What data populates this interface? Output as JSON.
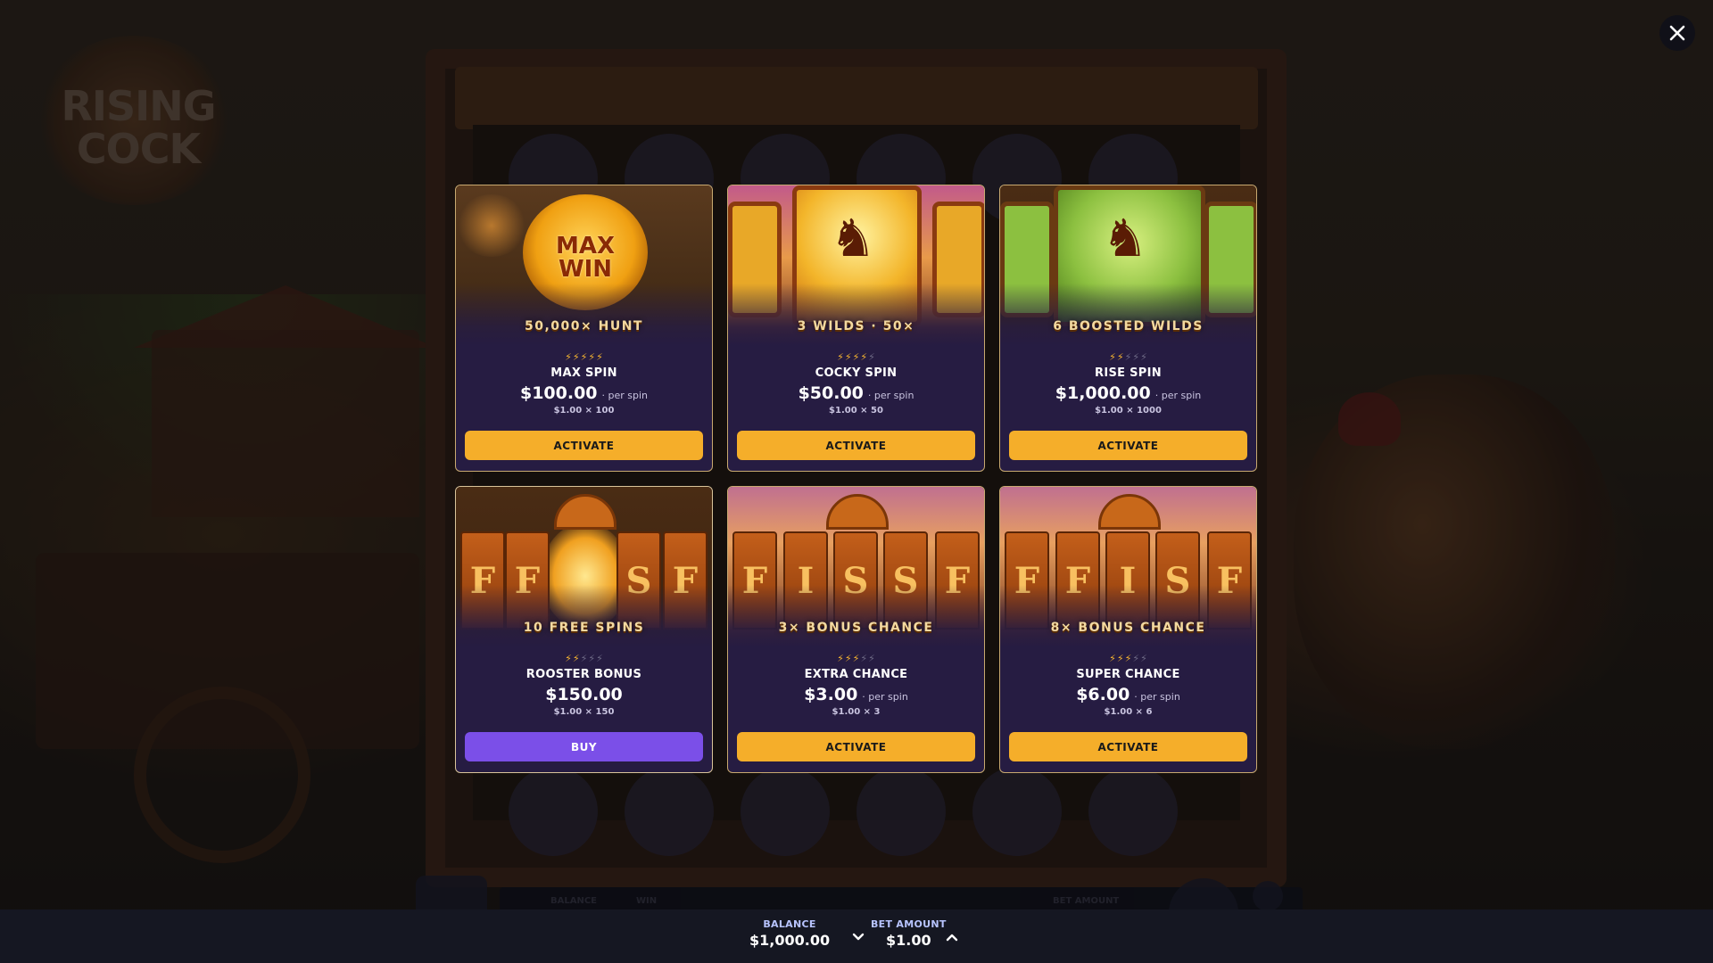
{
  "game": {
    "logo_text": [
      "RISING",
      "COCK"
    ],
    "toolbar_labels": {
      "balance": "BALANCE",
      "win": "WIN",
      "bet_amount": "BET AMOUNT"
    }
  },
  "modal": {
    "close_icon": "close-icon",
    "cards": [
      {
        "art_title": "50,000× HUNT",
        "bolts_on": 5,
        "bolts_total": 5,
        "name": "MAX SPIN",
        "price": "$100.00",
        "per_spin": "· per spin",
        "formula": "$1.00 × 100",
        "button": "ACTIVATE",
        "button_type": "activate"
      },
      {
        "art_title": "3 WILDS · 50×",
        "bolts_on": 4,
        "bolts_total": 5,
        "name": "COCKY SPIN",
        "price": "$50.00",
        "per_spin": "· per spin",
        "formula": "$1.00 × 50",
        "button": "ACTIVATE",
        "button_type": "activate"
      },
      {
        "art_title": "6 BOOSTED WILDS",
        "bolts_on": 2,
        "bolts_total": 5,
        "name": "RISE SPIN",
        "price": "$1,000.00",
        "per_spin": "· per spin",
        "formula": "$1.00 × 1000",
        "button": "ACTIVATE",
        "button_type": "activate"
      },
      {
        "art_title": "10 FREE SPINS",
        "bolts_on": 2,
        "bolts_total": 5,
        "name": "ROOSTER BONUS",
        "price": "$150.00",
        "per_spin": "",
        "formula": "$1.00 × 150",
        "button": "BUY",
        "button_type": "buy"
      },
      {
        "art_title": "3× BONUS CHANCE",
        "bolts_on": 3,
        "bolts_total": 5,
        "name": "EXTRA CHANCE",
        "price": "$3.00",
        "per_spin": "· per spin",
        "formula": "$1.00 × 3",
        "button": "ACTIVATE",
        "button_type": "activate"
      },
      {
        "art_title": "8× BONUS CHANCE",
        "bolts_on": 3,
        "bolts_total": 5,
        "name": "SUPER CHANCE",
        "price": "$6.00",
        "per_spin": "· per spin",
        "formula": "$1.00 × 6",
        "button": "ACTIVATE",
        "button_type": "activate"
      }
    ]
  },
  "status_bar": {
    "balance_label": "BALANCE",
    "balance_value": "$1,000.00",
    "bet_label": "BET AMOUNT",
    "bet_value": "$1.00",
    "decrease_icon": "chevron-down-icon",
    "increase_icon": "chevron-up-icon"
  },
  "colors": {
    "accent_activate": "#f5ae2a",
    "accent_buy": "#7b4fe8",
    "card_bg": "#261c42",
    "bolt_on": "#f8b630",
    "bolt_off": "#6e6a86",
    "status_label": "#b8c4ff"
  }
}
